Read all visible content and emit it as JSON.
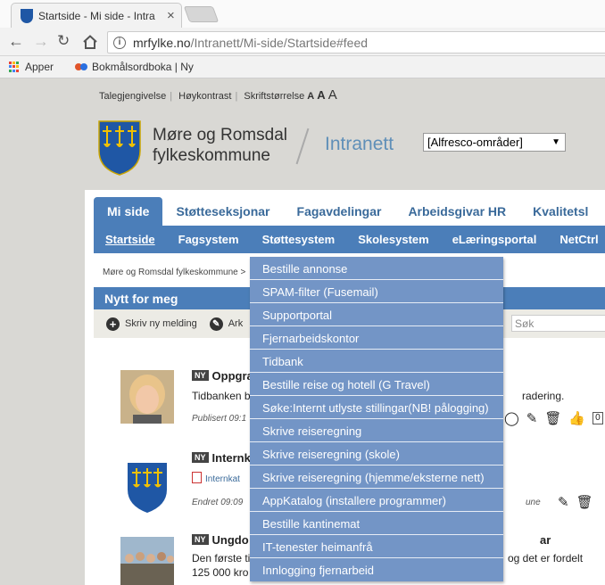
{
  "browser": {
    "tab_title": "Startside - Mi side - Intra",
    "url_host": "mrfylke.no",
    "url_path": "/Intranett/Mi-side/Startside#feed",
    "bookmarks": [
      {
        "label": "Apper"
      },
      {
        "label": "Bokmålsordboka | Ny"
      }
    ]
  },
  "access_bar": {
    "items": [
      "Talegjengivelse",
      "Høykontrast",
      "Skriftstørrelse"
    ],
    "font_a_small": "A",
    "font_a_mid": "A",
    "font_a_big": "A"
  },
  "header": {
    "org_line1": "Møre og Romsdal",
    "org_line2": "fylkeskommune",
    "site_name": "Intranett",
    "area_select": "[Alfresco-områder]"
  },
  "main_tabs": [
    {
      "label": "Mi side",
      "active": true
    },
    {
      "label": "Støtteseksjonar"
    },
    {
      "label": "Fagavdelingar"
    },
    {
      "label": "Arbeidsgivar HR"
    },
    {
      "label": "Kvalitetsl"
    }
  ],
  "sub_nav": [
    {
      "label": "Startside",
      "active": true
    },
    {
      "label": "Fagsystem"
    },
    {
      "label": "Støttesystem"
    },
    {
      "label": "Skolesystem"
    },
    {
      "label": "eLæringsportal"
    },
    {
      "label": "NetCtrl"
    }
  ],
  "breadcrumb": "Møre og Romsdal fylkeskommune >",
  "feed_box": {
    "title": "Nytt for meg",
    "write_label": "Skriv ny melding",
    "archive_label": "Ark",
    "search_placeholder": "Søk"
  },
  "feed": [
    {
      "badge": "NY",
      "title": "Oppgra",
      "text_left": "Tidbanken b",
      "text_right": "radering.",
      "meta": "Publisert 09:1",
      "like_count": "0"
    },
    {
      "badge": "NY",
      "title": "Internk",
      "attachment": "Internkat",
      "meta": "Endret 09:09",
      "meta_right": "une"
    },
    {
      "badge": "NY",
      "title": "Ungdo",
      "title_right": "ar",
      "text_left": "Den første ti",
      "text_right": "og det er fordelt",
      "text_line2": "125 000 kro"
    }
  ],
  "dropdown": {
    "items": [
      "Bestille annonse",
      "SPAM-filter (Fusemail)",
      "Supportportal",
      "Fjernarbeidskontor",
      "Tidbank",
      "Bestille reise og hotell (G Travel)",
      "Søke:Internt utlyste stillingar(NB! pålogging)",
      "Skrive reiseregning",
      "Skrive reiseregning (skole)",
      "Skrive reiseregning (hjemme/eksterne nett)",
      "AppKatalog (installere programmer)",
      "Bestille kantinemat",
      "IT-tenester heimanfrå",
      "Innlogging fjernarbeid"
    ]
  },
  "colors": {
    "accent": "#4b7eb9",
    "dropdown_bg": "#7395c6",
    "page_bg": "#d9d8d4"
  }
}
